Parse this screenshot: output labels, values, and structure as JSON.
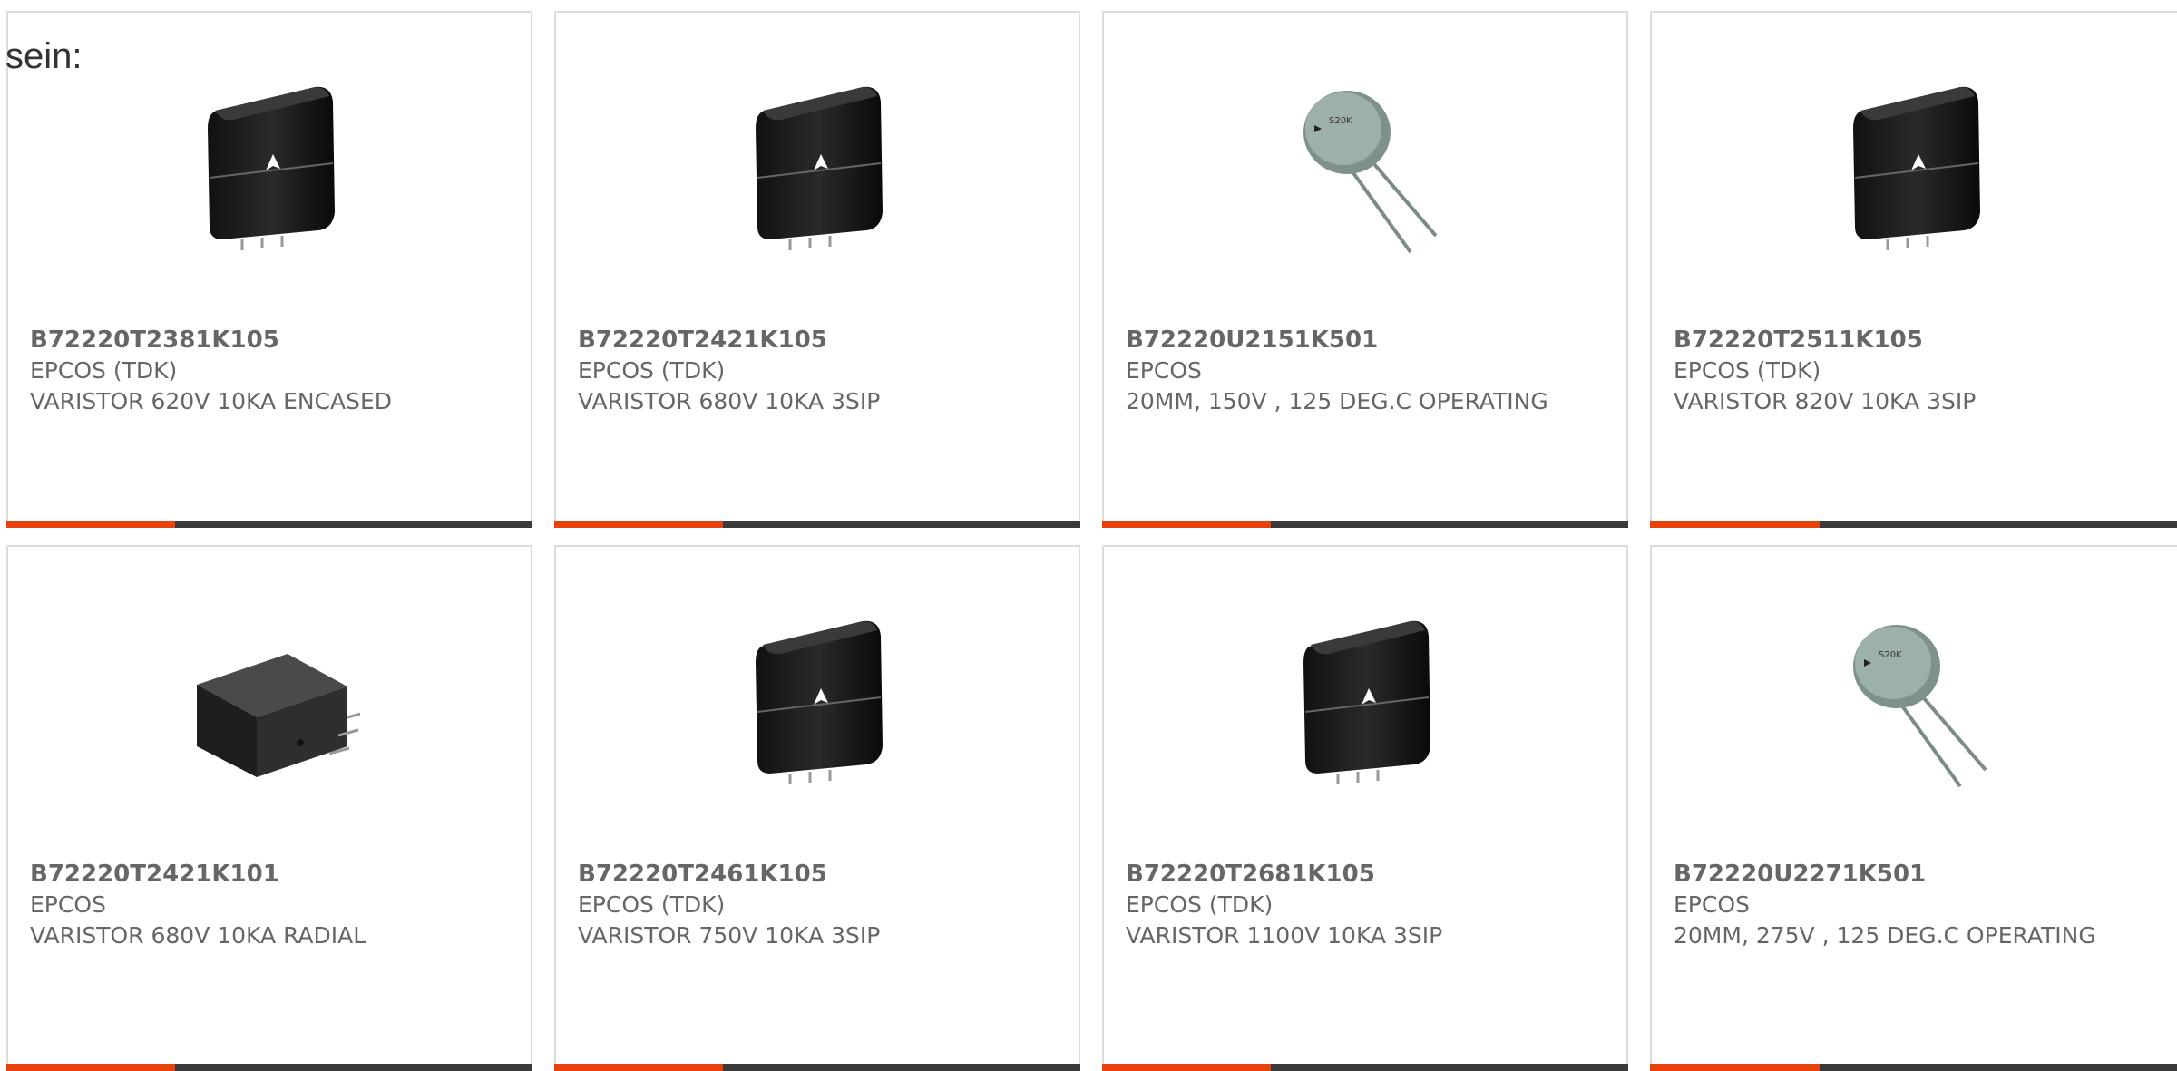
{
  "intro_text": "sein:",
  "colors": {
    "accent": "#e8420c",
    "bar": "#3a3a3a",
    "text": "#666666",
    "border": "#dcdcdc"
  },
  "products": [
    {
      "part_number": "B72220T2381K105",
      "manufacturer": "EPCOS (TDK)",
      "description": "VARISTOR 620V 10KA ENCASED",
      "image": "encased-varistor-image"
    },
    {
      "part_number": "B72220T2421K105",
      "manufacturer": "EPCOS (TDK)",
      "description": "VARISTOR 680V 10KA 3SIP",
      "image": "encased-varistor-image"
    },
    {
      "part_number": "B72220U2151K501",
      "manufacturer": "EPCOS",
      "description": "20MM, 150V , 125 DEG.C OPERATING",
      "image": "disc-varistor-image"
    },
    {
      "part_number": "B72220T2511K105",
      "manufacturer": "EPCOS (TDK)",
      "description": "VARISTOR 820V 10KA 3SIP",
      "image": "encased-varistor-image"
    },
    {
      "part_number": "B72220T2421K101",
      "manufacturer": "EPCOS",
      "description": "VARISTOR 680V 10KA RADIAL",
      "image": "block-varistor-image"
    },
    {
      "part_number": "B72220T2461K105",
      "manufacturer": "EPCOS (TDK)",
      "description": "VARISTOR 750V 10KA 3SIP",
      "image": "encased-varistor-image"
    },
    {
      "part_number": "B72220T2681K105",
      "manufacturer": "EPCOS (TDK)",
      "description": "VARISTOR 1100V 10KA 3SIP",
      "image": "encased-varistor-image"
    },
    {
      "part_number": "B72220U2271K501",
      "manufacturer": "EPCOS",
      "description": "20MM, 275V , 125 DEG.C OPERATING",
      "image": "disc-varistor-image"
    }
  ]
}
